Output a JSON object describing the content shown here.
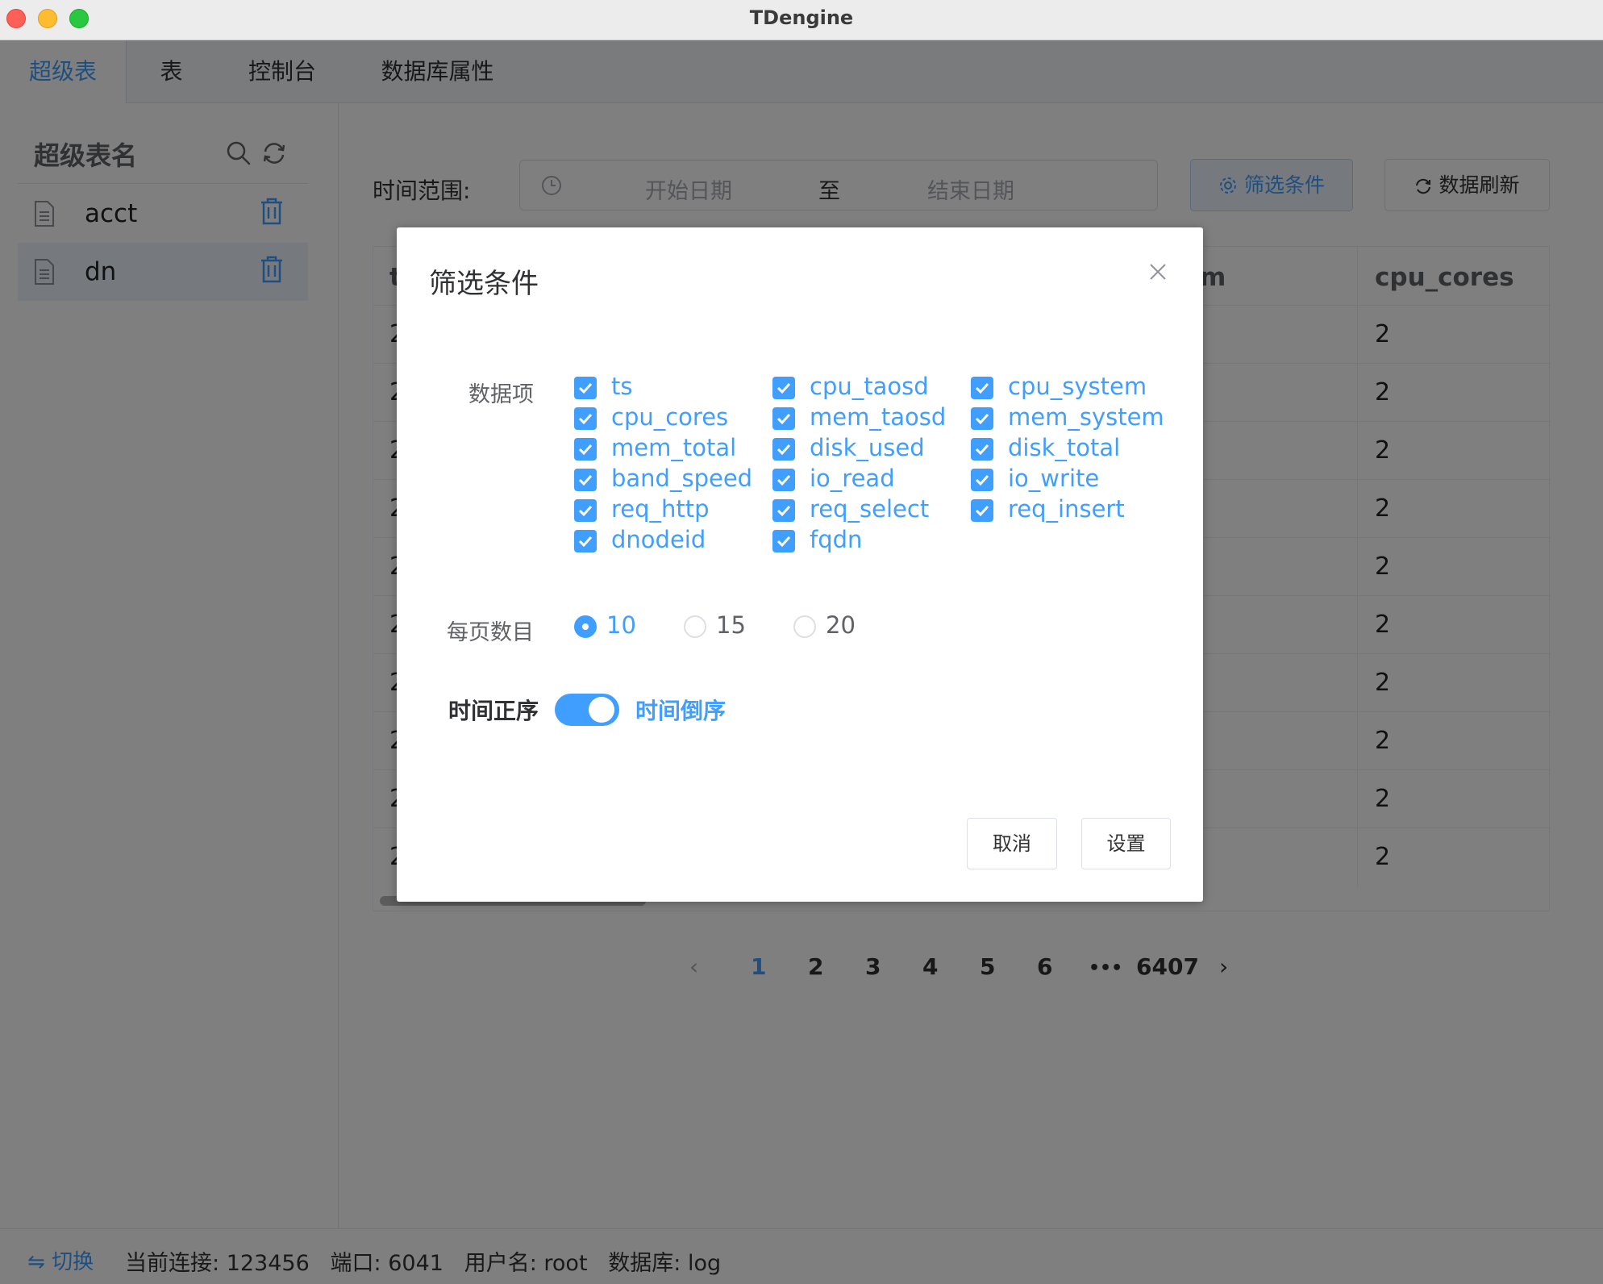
{
  "window": {
    "title": "TDengine"
  },
  "tabs": [
    {
      "label": "超级表",
      "active": true
    },
    {
      "label": "表"
    },
    {
      "label": "控制台"
    },
    {
      "label": "数据库属性"
    }
  ],
  "sidebar": {
    "title": "超级表名",
    "items": [
      {
        "name": "acct",
        "selected": false
      },
      {
        "name": "dn",
        "selected": true
      }
    ]
  },
  "toolbar": {
    "time_label": "时间范围:",
    "start_placeholder": "开始日期",
    "range_separator": "至",
    "end_placeholder": "结束日期",
    "filter_button": "筛选条件",
    "refresh_button": "数据刷新"
  },
  "table": {
    "visible_headers": [
      "t",
      "m",
      "cpu_cores"
    ],
    "first_column_cells": [
      "2",
      "2",
      "2",
      "2",
      "2",
      "2",
      "2",
      "2",
      "2",
      "2"
    ],
    "cpu_cores_cells": [
      "2",
      "2",
      "2",
      "2",
      "2",
      "2",
      "2",
      "2",
      "2",
      "2"
    ]
  },
  "pagination": {
    "pages": [
      "1",
      "2",
      "3",
      "4",
      "5",
      "6"
    ],
    "ellipsis": "•••",
    "last_page": "6407",
    "current": "1",
    "prev": "‹",
    "next": "›"
  },
  "statusbar": {
    "switch_label": "切换",
    "connection_label": "当前连接:",
    "connection_value": "123456",
    "port_label": "端口:",
    "port_value": "6041",
    "user_label": "用户名:",
    "user_value": "root",
    "db_label": "数据库:",
    "db_value": "log"
  },
  "dialog": {
    "title": "筛选条件",
    "fields_label": "数据项",
    "fields": [
      "ts",
      "cpu_taosd",
      "cpu_system",
      "cpu_cores",
      "mem_taosd",
      "mem_system",
      "mem_total",
      "disk_used",
      "disk_total",
      "band_speed",
      "io_read",
      "io_write",
      "req_http",
      "req_select",
      "req_insert",
      "dnodeid",
      "fqdn"
    ],
    "page_size_label": "每页数目",
    "page_sizes": [
      "10",
      "15",
      "20"
    ],
    "page_size_selected": "10",
    "order_left": "时间正序",
    "order_right": "时间倒序",
    "order_desc": true,
    "cancel_button": "取消",
    "confirm_button": "设置"
  },
  "colors": {
    "accent": "#409eff",
    "overlay": "rgba(0,0,0,0.5)"
  }
}
